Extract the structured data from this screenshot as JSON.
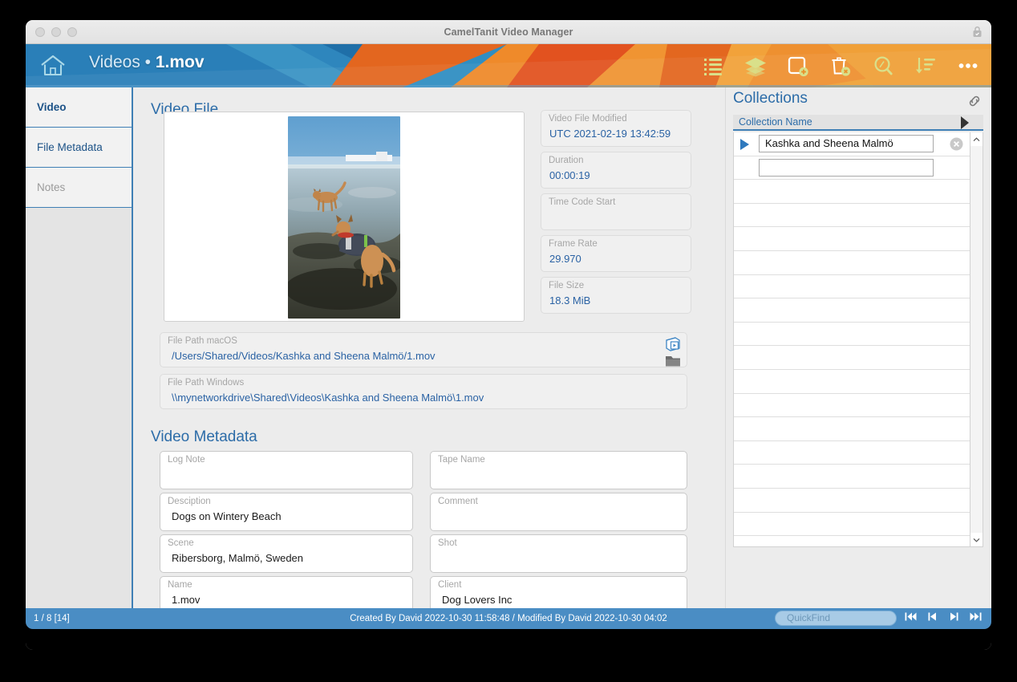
{
  "window": {
    "title": "CamelTanit Video Manager",
    "lock_icon": "lock-icon",
    "traffic_lights": [
      "close",
      "minimize",
      "zoom"
    ]
  },
  "banner": {
    "home_icon": "home-icon",
    "breadcrumb_layout": "Videos",
    "breadcrumb_separator": " • ",
    "record_name": "1.mov",
    "toolbar": [
      {
        "name": "list-view-icon",
        "label": "List View"
      },
      {
        "name": "layers-icon",
        "label": "Layers"
      },
      {
        "name": "new-record-icon",
        "label": "New Record"
      },
      {
        "name": "delete-record-icon",
        "label": "Delete Record"
      },
      {
        "name": "search-icon",
        "label": "Find"
      },
      {
        "name": "sort-icon",
        "label": "Sort"
      },
      {
        "name": "more-icon",
        "label": "More"
      }
    ]
  },
  "sidebar": {
    "items": [
      {
        "label": "Video",
        "state": "active"
      },
      {
        "label": "File Metadata",
        "state": "normal"
      },
      {
        "label": "Notes",
        "state": "dim"
      }
    ]
  },
  "main": {
    "video_file_heading": "Video File",
    "video_metadata_heading": "Video Metadata",
    "thumbnail": "video-thumbnail-dogs-on-beach",
    "info_fields": [
      {
        "label": "Video File Modified",
        "value": "UTC 2021-02-19 13:42:59"
      },
      {
        "label": "Duration",
        "value": "00:00:19"
      },
      {
        "label": "Time Code Start",
        "value": ""
      },
      {
        "label": "Frame Rate",
        "value": "29.970"
      },
      {
        "label": "File Size",
        "value": "18.3 MiB"
      }
    ],
    "path_fields": [
      {
        "label": "File Path macOS",
        "value": "/Users/Shared/Videos/Kashka and Sheena Malmö/1.mov"
      },
      {
        "label": "File Path Windows",
        "value": "\\\\mynetworkdrive\\Shared\\Videos\\Kashka and Sheena Malmö\\1.mov"
      }
    ],
    "path_icons": [
      {
        "name": "open-in-player-icon"
      },
      {
        "name": "reveal-in-folder-icon"
      }
    ],
    "metadata_left": [
      {
        "label": "Log Note",
        "value": ""
      },
      {
        "label": "Desciption",
        "value": "Dogs on Wintery Beach"
      },
      {
        "label": "Scene",
        "value": "Ribersborg, Malmö, Sweden"
      },
      {
        "label": "Name",
        "value": "1.mov"
      }
    ],
    "metadata_right": [
      {
        "label": "Tape Name",
        "value": ""
      },
      {
        "label": "Comment",
        "value": ""
      },
      {
        "label": "Shot",
        "value": ""
      },
      {
        "label": "Client",
        "value": "Dog Lovers Inc"
      }
    ]
  },
  "collections": {
    "heading": "Collections",
    "link_icon": "link-icon",
    "column_header": "Collection Name",
    "sort_arrow_icon": "play-arrow-icon",
    "rows": [
      {
        "value": "Kashka and Sheena Malmö",
        "has_caret": true,
        "has_input": true,
        "has_delete": true
      },
      {
        "value": "",
        "has_caret": false,
        "has_input": true,
        "has_delete": false
      }
    ],
    "empty_row_count": 18,
    "scroll_up_icon": "chevron-up-icon",
    "scroll_down_icon": "chevron-down-icon"
  },
  "status": {
    "record_counter": "1 / 8 [14]",
    "created_modified": "Created By David 2022-10-30 11:58:48 / Modified By David 2022-10-30 04:02",
    "quickfind_placeholder": "QuickFind",
    "quickfind_value": "",
    "nav_buttons": [
      {
        "name": "first-record-button"
      },
      {
        "name": "previous-record-button"
      },
      {
        "name": "next-record-button"
      },
      {
        "name": "last-record-button"
      }
    ]
  },
  "colors": {
    "accent_blue": "#2c6ca8",
    "banner_orange": "#e8922e",
    "banner_blue": "#2a7fb8",
    "status_blue": "#4a8dc4",
    "toolbar_icon": "#d9e08a",
    "field_text_blue": "#2a62a4"
  }
}
